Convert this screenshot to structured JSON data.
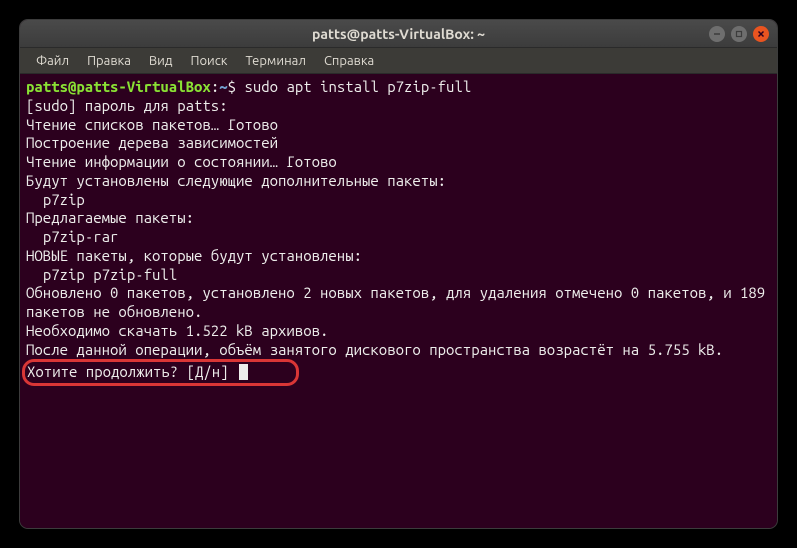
{
  "window": {
    "title": "patts@patts-VirtualBox: ~"
  },
  "menubar": {
    "items": [
      "Файл",
      "Правка",
      "Вид",
      "Поиск",
      "Терминал",
      "Справка"
    ]
  },
  "prompt": {
    "user_host": "patts@patts-VirtualBox",
    "colon": ":",
    "path": "~",
    "symbol": "$",
    "command": "sudo apt install p7zip-full"
  },
  "output": [
    "[sudo] пароль для patts:",
    "Чтение списков пакетов… Готово",
    "Построение дерева зависимостей",
    "Чтение информации о состоянии… Готово",
    "Будут установлены следующие дополнительные пакеты:",
    "  p7zip",
    "Предлагаемые пакеты:",
    "  p7zip-rar",
    "НОВЫЕ пакеты, которые будут установлены:",
    "  p7zip p7zip-full",
    "Обновлено 0 пакетов, установлено 2 новых пакетов, для удаления отмечено 0 пакетов, и 189 пакетов не обновлено.",
    "Необходимо скачать 1.522 kB архивов.",
    "После данной операции, объём занятого дискового пространства возрастёт на 5.755 kB."
  ],
  "prompt_question": "Хотите продолжить? [Д/н] "
}
